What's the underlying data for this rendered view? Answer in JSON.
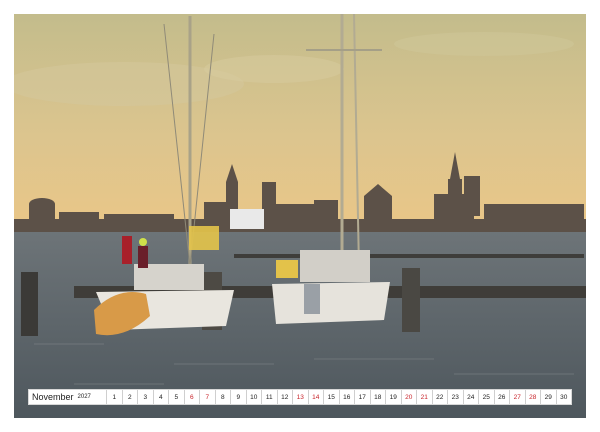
{
  "calendar": {
    "month": "November",
    "year": "2027",
    "days": [
      {
        "n": "1",
        "sun": false
      },
      {
        "n": "2",
        "sun": false
      },
      {
        "n": "3",
        "sun": false
      },
      {
        "n": "4",
        "sun": false
      },
      {
        "n": "5",
        "sun": false
      },
      {
        "n": "6",
        "sun": true
      },
      {
        "n": "7",
        "sun": true
      },
      {
        "n": "8",
        "sun": false
      },
      {
        "n": "9",
        "sun": false
      },
      {
        "n": "10",
        "sun": false
      },
      {
        "n": "11",
        "sun": false
      },
      {
        "n": "12",
        "sun": false
      },
      {
        "n": "13",
        "sun": true
      },
      {
        "n": "14",
        "sun": true
      },
      {
        "n": "15",
        "sun": false
      },
      {
        "n": "16",
        "sun": false
      },
      {
        "n": "17",
        "sun": false
      },
      {
        "n": "18",
        "sun": false
      },
      {
        "n": "19",
        "sun": false
      },
      {
        "n": "20",
        "sun": true
      },
      {
        "n": "21",
        "sun": true
      },
      {
        "n": "22",
        "sun": false
      },
      {
        "n": "23",
        "sun": false
      },
      {
        "n": "24",
        "sun": false
      },
      {
        "n": "25",
        "sun": false
      },
      {
        "n": "26",
        "sun": false
      },
      {
        "n": "27",
        "sun": true
      },
      {
        "n": "28",
        "sun": true
      },
      {
        "n": "29",
        "sun": false
      },
      {
        "n": "30",
        "sun": false
      }
    ]
  },
  "photo": {
    "subject": "harbor-sailboats-city-skyline",
    "colors": {
      "sky_top": "#c9c08f",
      "sky_bottom": "#e7c68a",
      "water": "#5f6a72",
      "skyline": "#5a4f46",
      "hull": "#e9e6df",
      "dinghy": "#d99a45"
    }
  },
  "binding": {
    "icon": "spiral-binding-icon"
  }
}
